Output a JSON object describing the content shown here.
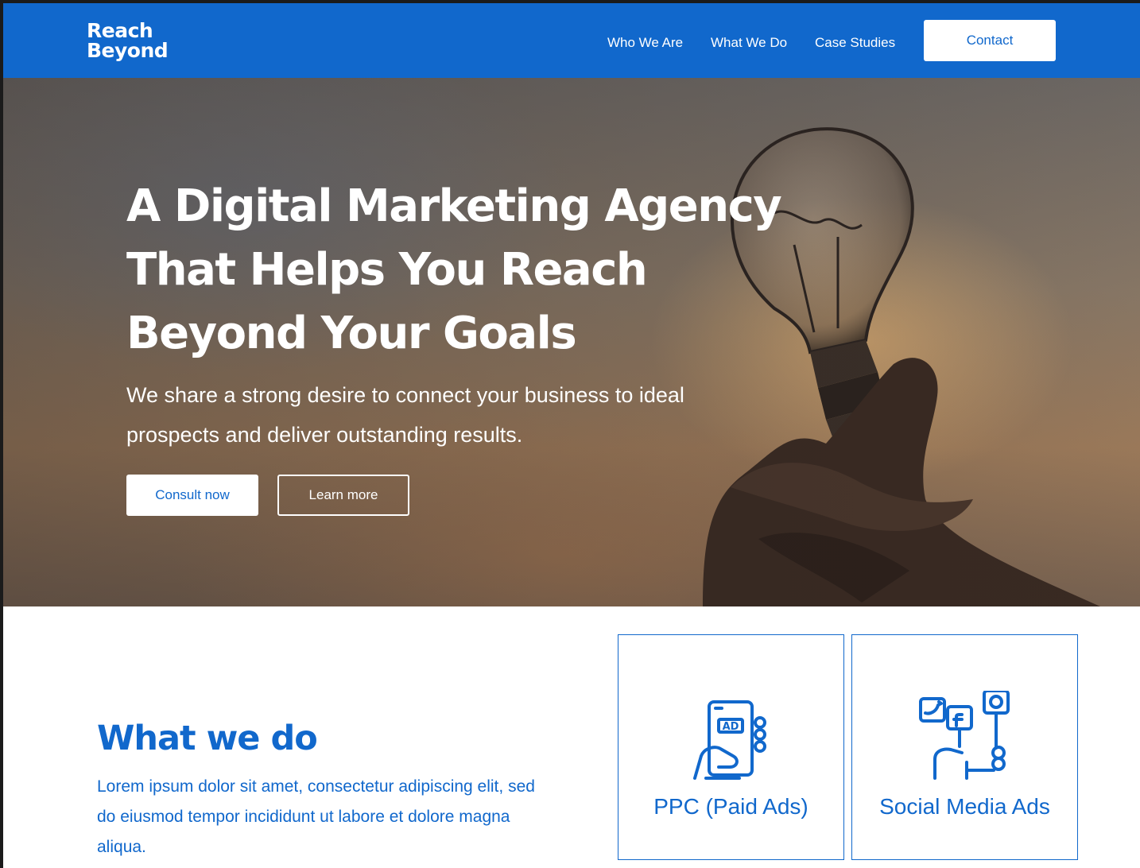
{
  "brand": {
    "line1": "Reach",
    "line2": "Beyond",
    "accent": "#1168cc"
  },
  "nav": {
    "items": [
      "Who We Are",
      "What We Do",
      "Case Studies"
    ],
    "contact_label": "Contact"
  },
  "hero": {
    "title": "A Digital Marketing Agency That Helps You Reach Beyond Your Goals",
    "subtitle": "We share a strong desire to connect your business to ideal prospects and deliver outstanding results.",
    "primary_button": "Consult now",
    "secondary_button": "Learn more",
    "background_icon": "lightbulb-in-hand"
  },
  "what_we_do": {
    "title": "What we do",
    "text": "Lorem ipsum dolor sit amet, consectetur adipiscing elit, sed do eiusmod tempor incididunt ut labore et dolore magna aliqua.",
    "services": [
      {
        "label": "PPC (Paid Ads)",
        "icon": "phone-ad-icon"
      },
      {
        "label": "Social Media Ads",
        "icon": "social-media-icon"
      }
    ]
  }
}
